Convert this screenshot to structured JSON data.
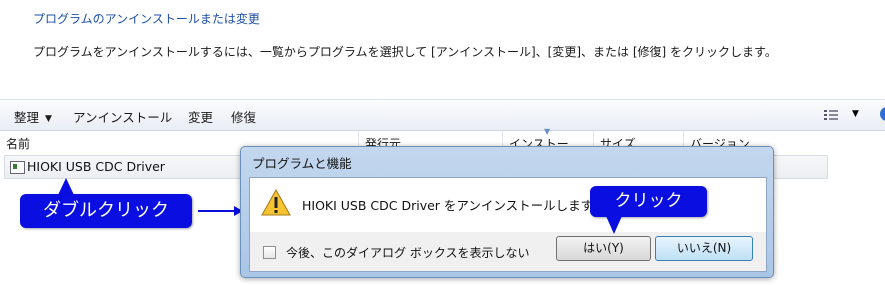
{
  "page": {
    "title": "プログラムのアンインストールまたは変更",
    "description": "プログラムをアンインストールするには、一覧からプログラムを選択して [アンインストール]、[変更]、または [修復] をクリックします。"
  },
  "toolbar": {
    "organize": "整理",
    "uninstall": "アンインストール",
    "change": "変更",
    "repair": "修復",
    "view_icon": "view-list-icon",
    "help_icon": "help-icon"
  },
  "columns": [
    "名前",
    "発行元",
    "インストー",
    "サイズ",
    "バージョン"
  ],
  "programs": [
    {
      "name": "HIOKI USB CDC Driver",
      "icon": "program-icon"
    }
  ],
  "annotations": {
    "double_click": "ダブルクリック",
    "click": "クリック",
    "color": "#0a0ee0"
  },
  "dialog": {
    "title": "プログラムと機能",
    "message": "HIOKI USB CDC Driver をアンインストールしますか",
    "checkbox_label": "今後、このダイアログ ボックスを表示しない",
    "checkbox_checked": false,
    "yes_button": "はい(Y)",
    "no_button": "いいえ(N)",
    "icon": "warning-icon"
  }
}
